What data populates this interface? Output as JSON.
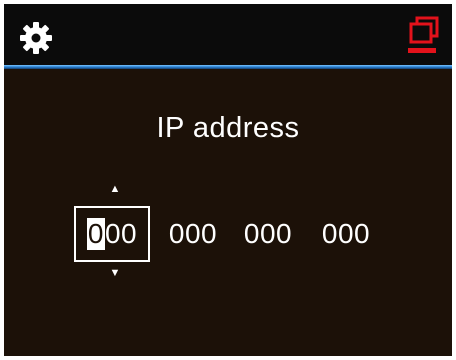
{
  "title": "IP address",
  "arrows": {
    "up": "▲",
    "down": "▼"
  },
  "fields": [
    {
      "digit1": "0",
      "rest": "00"
    },
    {
      "value": "000"
    },
    {
      "value": "000"
    },
    {
      "value": "000"
    }
  ],
  "icons": {
    "left": "gear-icon",
    "right": "window-stack-icon"
  },
  "colors": {
    "background": "#1c1108",
    "header": "#0b0b0b",
    "accent_blue": "#2f86d8",
    "accent_red": "#e3121b",
    "text": "#ffffff"
  }
}
